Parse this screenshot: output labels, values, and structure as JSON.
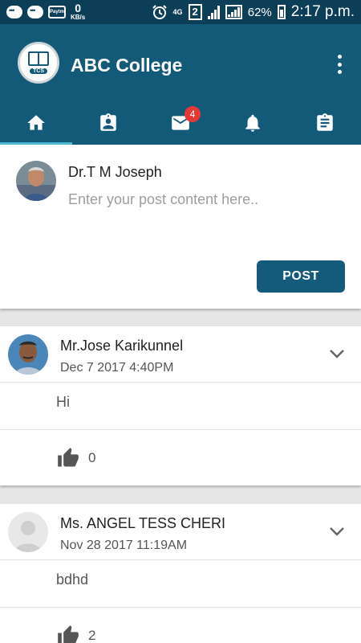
{
  "status_bar": {
    "speed_value": "0",
    "speed_unit": "KB/s",
    "network": "4G",
    "sim": "2",
    "battery": "62%",
    "time": "2:17 p.m.",
    "paytm_label": "Paytm"
  },
  "app": {
    "title": "ABC College",
    "logo_text": "TCS"
  },
  "tabs": [
    {
      "icon": "home-icon",
      "active": true
    },
    {
      "icon": "contact-badge-icon"
    },
    {
      "icon": "mail-icon",
      "badge": "4"
    },
    {
      "icon": "bell-icon"
    },
    {
      "icon": "clipboard-icon"
    }
  ],
  "compose": {
    "user_name": "Dr.T M Joseph",
    "placeholder": "Enter your post content here..",
    "value": "",
    "post_label": "POST"
  },
  "posts": [
    {
      "author": "Mr.Jose Karikunnel",
      "date": "Dec  7 2017  4:40PM",
      "body": "Hi",
      "likes": "0"
    },
    {
      "author": "Ms. ANGEL TESS CHERI",
      "date": "Nov 28 2017 11:19AM",
      "body": "bdhd",
      "likes": "2"
    }
  ],
  "colors": {
    "app_bar": "#135a79",
    "status_bar": "#0c3f57",
    "tab_indicator": "#4dbad4",
    "post_button": "#145a7a",
    "badge": "#e53935"
  }
}
